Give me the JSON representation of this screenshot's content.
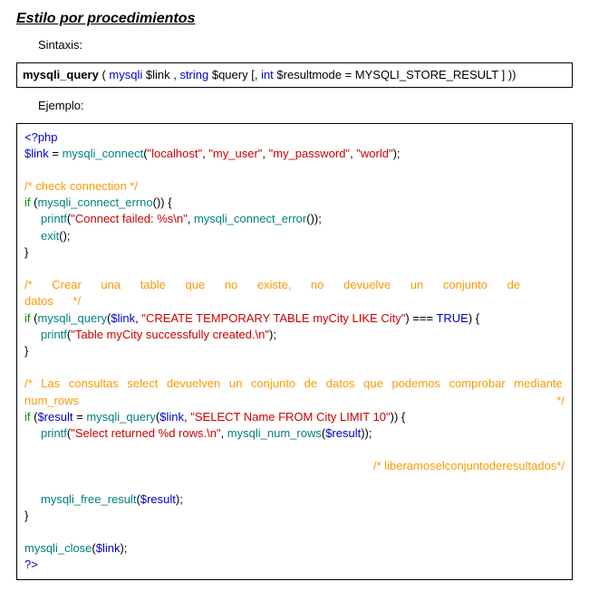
{
  "heading": "Estilo por procedimientos",
  "syntax_label": "Sintaxis:",
  "example_label": "Ejemplo:",
  "signature": {
    "fn": "mysqli_query",
    "open": " ( ",
    "type1": "mysqli",
    "arg1": " $link",
    "comma1": " , ",
    "type2": "string",
    "arg2": " $query",
    "opt": " [, ",
    "type3": "int",
    "arg3": " $resultmode",
    "eq": " = MYSQLI_STORE_RESULT ] ))"
  },
  "code": {
    "l1": {
      "t": "<?php"
    },
    "l2a": "$link",
    "l2b": " = ",
    "l2c": "mysqli_connect",
    "l2d": "(",
    "l2s1": "\"localhost\"",
    "l2s2": "\"my_user\"",
    "l2s3": "\"my_password\"",
    "l2s4": "\"world\"",
    "l2e": ", ",
    "l2f": ");",
    "c1": "/* check connection */",
    "l3a": "if",
    "l3b": " (",
    "l3c": "mysqli_connect_errno",
    "l3d": "()) {",
    "l4a": "printf",
    "l4b": "(",
    "l4st": "\"Connect failed: %s\\n\"",
    "l4c": ", ",
    "l4d": "mysqli_connect_error",
    "l4e": "());",
    "l5a": "exit",
    "l5b": "();",
    "l6": "}",
    "c2": "/* Crear una table que no existe, no devuelve un conjunto de datos */",
    "l7a": "if",
    "l7b": " (",
    "l7c": "mysqli_query",
    "l7d": "(",
    "l7e": "$link",
    "l7f": ", ",
    "l7st": "\"CREATE TEMPORARY TABLE myCity LIKE City\"",
    "l7g": ") === ",
    "l7h": "TRUE",
    "l7i": ") {",
    "l8a": "printf",
    "l8b": "(",
    "l8st": "\"Table myCity successfully created.\\n\"",
    "l8c": ");",
    "l9": "}",
    "c3a": "/* Las consultas select devuelven un conjunto de datos que podemos comprobar mediante",
    "c3b_left": "num_rows",
    "c3b_right": "*/",
    "l10a": "if",
    "l10b": " (",
    "l10c": "$result",
    "l10d": " = ",
    "l10e": "mysqli_query",
    "l10f": "(",
    "l10g": "$link",
    "l10h": ", ",
    "l10st": "\"SELECT Name FROM City LIMIT 10\"",
    "l10i": ")) {",
    "l11a": "printf",
    "l11b": "(",
    "l11st": "\"Select returned %d rows.\\n\"",
    "l11c": ", ",
    "l11d": "mysqli_num_rows",
    "l11e": "(",
    "l11f": "$result",
    "l11g": "));",
    "c4_w1": "/* liberamos",
    "c4_w2": "el",
    "c4_w3": "conjunto",
    "c4_w4": "de",
    "c4_w5": "resultados",
    "c4_w6": "*/",
    "l12a": "mysqli_free_result",
    "l12b": "(",
    "l12c": "$result",
    "l12d": ");",
    "l13": "}",
    "l14a": "mysqli_close",
    "l14b": "(",
    "l14c": "$link",
    "l14d": ");",
    "l15": "?>"
  }
}
